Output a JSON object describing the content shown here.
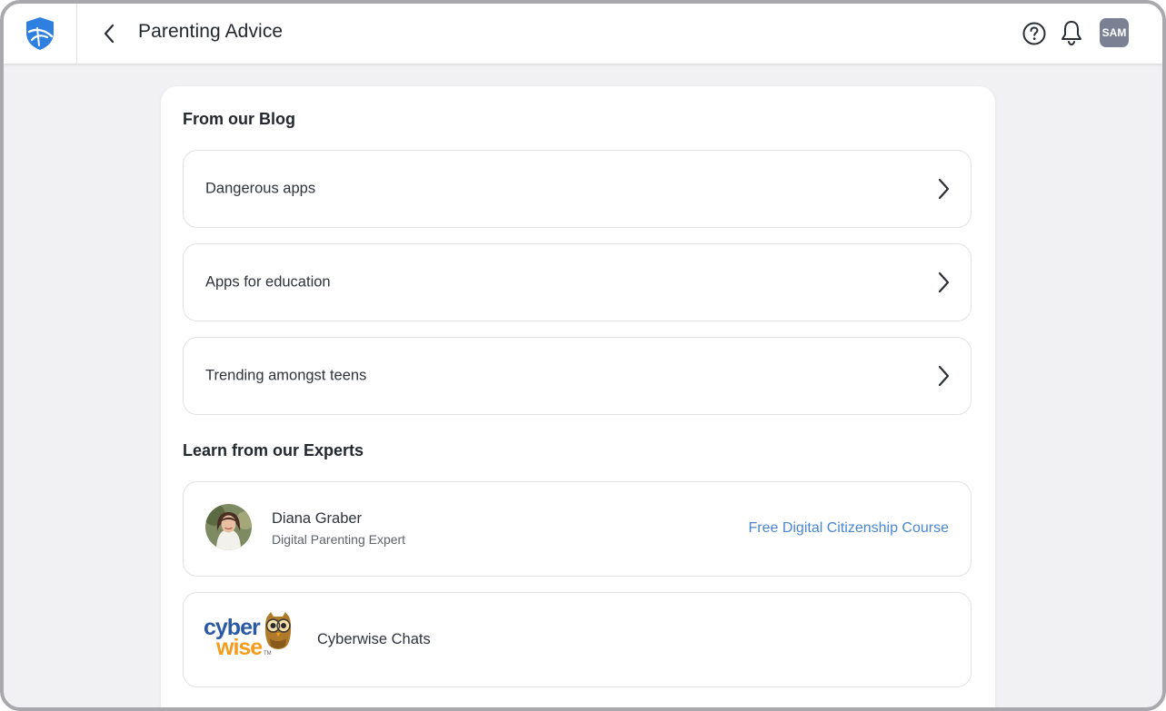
{
  "header": {
    "title": "Parenting Advice",
    "avatar_initials": "SAM",
    "logo_icon": "shield-logo-icon",
    "back_icon": "chevron-left-icon",
    "help_icon": "help-circle-icon",
    "notifications_icon": "bell-icon",
    "brand_color": "#2f7fe0"
  },
  "blog": {
    "title": "From our Blog",
    "items": [
      {
        "label": "Dangerous apps"
      },
      {
        "label": "Apps for education"
      },
      {
        "label": "Trending amongst teens"
      }
    ]
  },
  "experts": {
    "title": "Learn from our Experts",
    "items": [
      {
        "name": "Diana Graber",
        "role": "Digital Parenting Expert",
        "link_label": "Free Digital Citizenship Course",
        "link_color": "#4a86d6"
      },
      {
        "label": "Cyberwise Chats",
        "logo_text_top": "cyber",
        "logo_text_bottom": "wise",
        "logo_trademark": "TM"
      }
    ]
  }
}
